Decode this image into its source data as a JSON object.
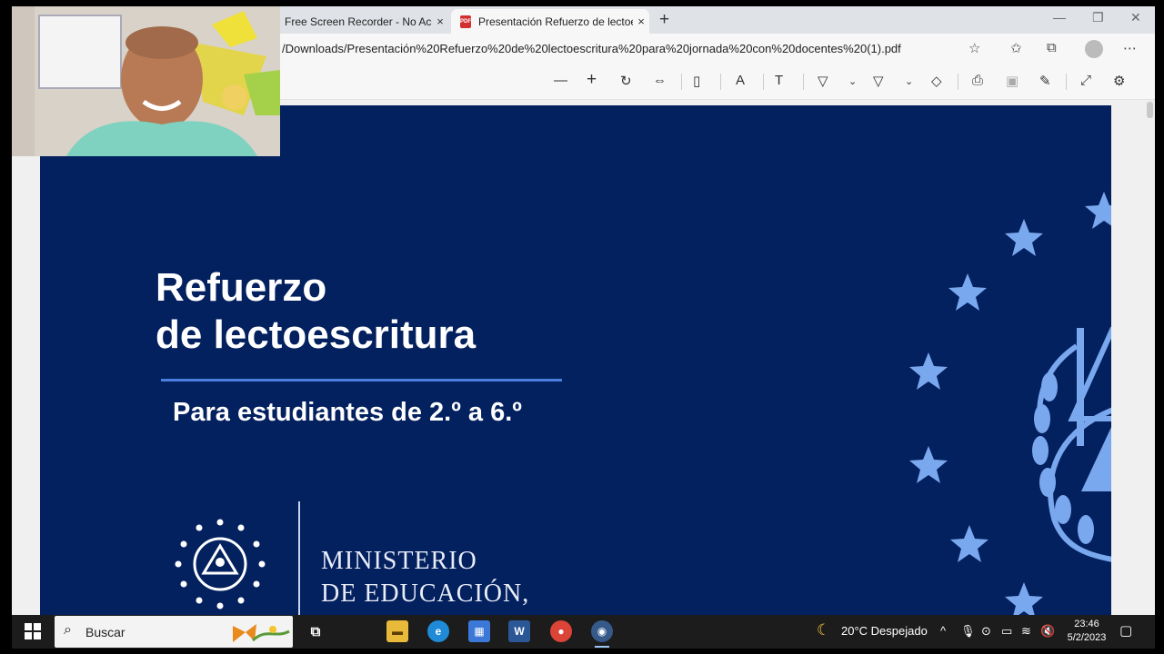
{
  "browser": {
    "tabs": [
      {
        "title": "Free Screen Recorder - No Accou",
        "close": "×"
      },
      {
        "title": "Presentación Refuerzo de lectoes",
        "close": "×"
      }
    ],
    "new_tab": "+",
    "window_controls": {
      "minimize": "—",
      "maximize": "❐",
      "close": "✕"
    },
    "url": "/Downloads/Presentación%20Refuerzo%20de%20lectoescritura%20para%20jornada%20con%20docentes%20(1).pdf",
    "pdf_icon_text": "PDF"
  },
  "pdf_toolbar": {
    "icons": [
      "minus-icon",
      "plus-icon",
      "rotate-icon",
      "fit-page-icon",
      "page-view-icon",
      "read-aloud-icon",
      "text-icon",
      "draw-icon",
      "highlight-icon",
      "erase-icon",
      "print-icon",
      "save-icon",
      "save-as-icon",
      "fullscreen-icon",
      "settings-icon"
    ]
  },
  "slide": {
    "title_line1": "Refuerzo",
    "title_line2": "de lectoescritura",
    "subtitle": "Para estudiantes de  2.º a 6.º",
    "ministry_line1": "MINISTERIO",
    "ministry_line2": "DE EDUCACIÓN,",
    "colors": {
      "background": "#03205f",
      "rule": "#4a7fe0",
      "stars": "#7aa8ee"
    }
  },
  "taskbar": {
    "search_label": "Buscar",
    "weather": "20°C  Despejado",
    "time": "23:46",
    "date": "5/2/2023",
    "apps": [
      "file-explorer-icon",
      "edge-icon",
      "store-icon",
      "word-icon",
      "chrome-icon",
      "recorder-icon"
    ]
  }
}
